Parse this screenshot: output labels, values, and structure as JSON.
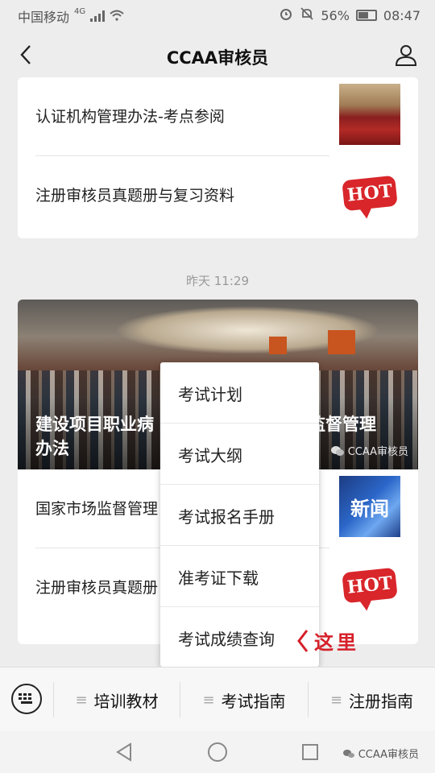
{
  "status_bar": {
    "carrier": "中国移动",
    "network": "4G",
    "battery": "56%",
    "time": "08:47"
  },
  "nav": {
    "title": "CCAA审核员"
  },
  "card1": {
    "rows": [
      {
        "title": "认证机构管理办法-考点参阅",
        "thumb": "crowd-photo"
      },
      {
        "title": "注册审核员真题册与复习资料",
        "thumb": "hot-badge"
      }
    ]
  },
  "hot_label": "HOT",
  "timestamp": "昨天 11:29",
  "card2": {
    "hero_title": "建设项目职业病危害… 监督管理办法",
    "hero_title_line1": "建设项目职业病",
    "hero_title_line1b": "监督管理",
    "hero_title_line2": "办法",
    "hero_source": "CCAA审核员",
    "rows": [
      {
        "title": "国家市场监督管理",
        "thumb": "news-graphic",
        "thumb_text": "新闻"
      },
      {
        "title": "注册审核员真题册",
        "thumb": "hot-badge"
      }
    ]
  },
  "popup_menu": {
    "items": [
      "考试计划",
      "考试大纲",
      "考试报名手册",
      "准考证下载",
      "考试成绩查询"
    ]
  },
  "annotation": "这里",
  "bottom_menu": {
    "buttons": [
      "培训教材",
      "考试指南",
      "注册指南"
    ]
  },
  "watermark": "CCAA审核员",
  "colors": {
    "accent_red": "#d6202a",
    "hot_red": "#d8262b",
    "background": "#ededed"
  }
}
